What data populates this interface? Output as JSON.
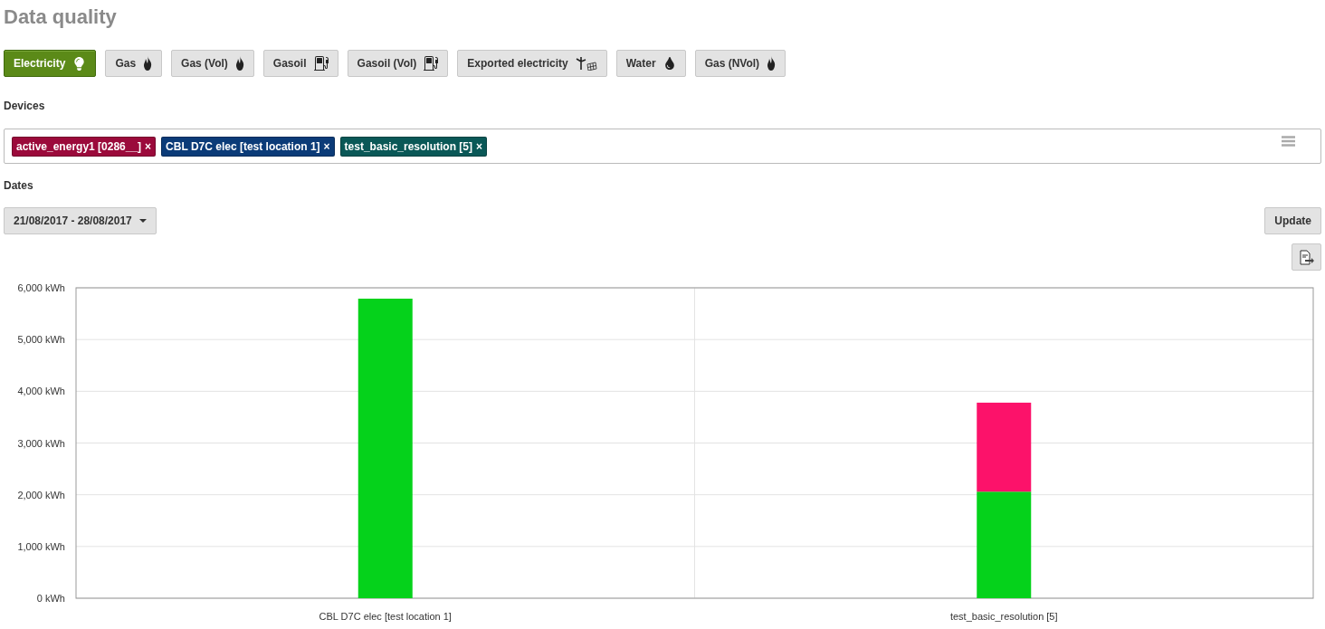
{
  "title": "Data quality",
  "energy_types": [
    {
      "label": "Electricity",
      "kind": "bulb",
      "selected": true
    },
    {
      "label": "Gas",
      "kind": "flame",
      "selected": false
    },
    {
      "label": "Gas (Vol)",
      "kind": "flame",
      "selected": false
    },
    {
      "label": "Gasoil",
      "kind": "pump",
      "selected": false
    },
    {
      "label": "Gasoil (Vol)",
      "kind": "pump",
      "selected": false
    },
    {
      "label": "Exported electricity",
      "kind": "renewables",
      "selected": false
    },
    {
      "label": "Water",
      "kind": "drop",
      "selected": false
    },
    {
      "label": "Gas (NVol)",
      "kind": "flame",
      "selected": false
    }
  ],
  "devices": {
    "label": "Devices",
    "tags": [
      {
        "label": "active_energy1 [0286__]",
        "remove": "×",
        "color": "#9b0a3b"
      },
      {
        "label": "CBL D7C elec [test location 1]",
        "remove": "×",
        "color": "#0b3b78"
      },
      {
        "label": "test_basic_resolution [5]",
        "remove": "×",
        "color": "#0a5857"
      }
    ]
  },
  "dates": {
    "label": "Dates",
    "range": "21/08/2017 - 28/08/2017",
    "update": "Update"
  },
  "chart_data": {
    "type": "bar",
    "stacked": true,
    "grid": true,
    "categories": [
      "CBL D7C elec [test location 1]",
      "test_basic_resolution [5]"
    ],
    "series": [
      {
        "color": "#05d21b",
        "values": [
          5790,
          2060
        ]
      },
      {
        "color": "#fc126a",
        "values": [
          0,
          1720
        ]
      }
    ],
    "ylim": [
      0,
      6000
    ],
    "yticks": [
      {
        "value": 0,
        "label": "0 kWh"
      },
      {
        "value": 1000,
        "label": "1,000 kWh"
      },
      {
        "value": 2000,
        "label": "2,000 kWh"
      },
      {
        "value": 3000,
        "label": "3,000 kWh"
      },
      {
        "value": 4000,
        "label": "4,000 kWh"
      },
      {
        "value": 5000,
        "label": "5,000 kWh"
      },
      {
        "value": 6000,
        "label": "6,000 kWh"
      }
    ]
  }
}
